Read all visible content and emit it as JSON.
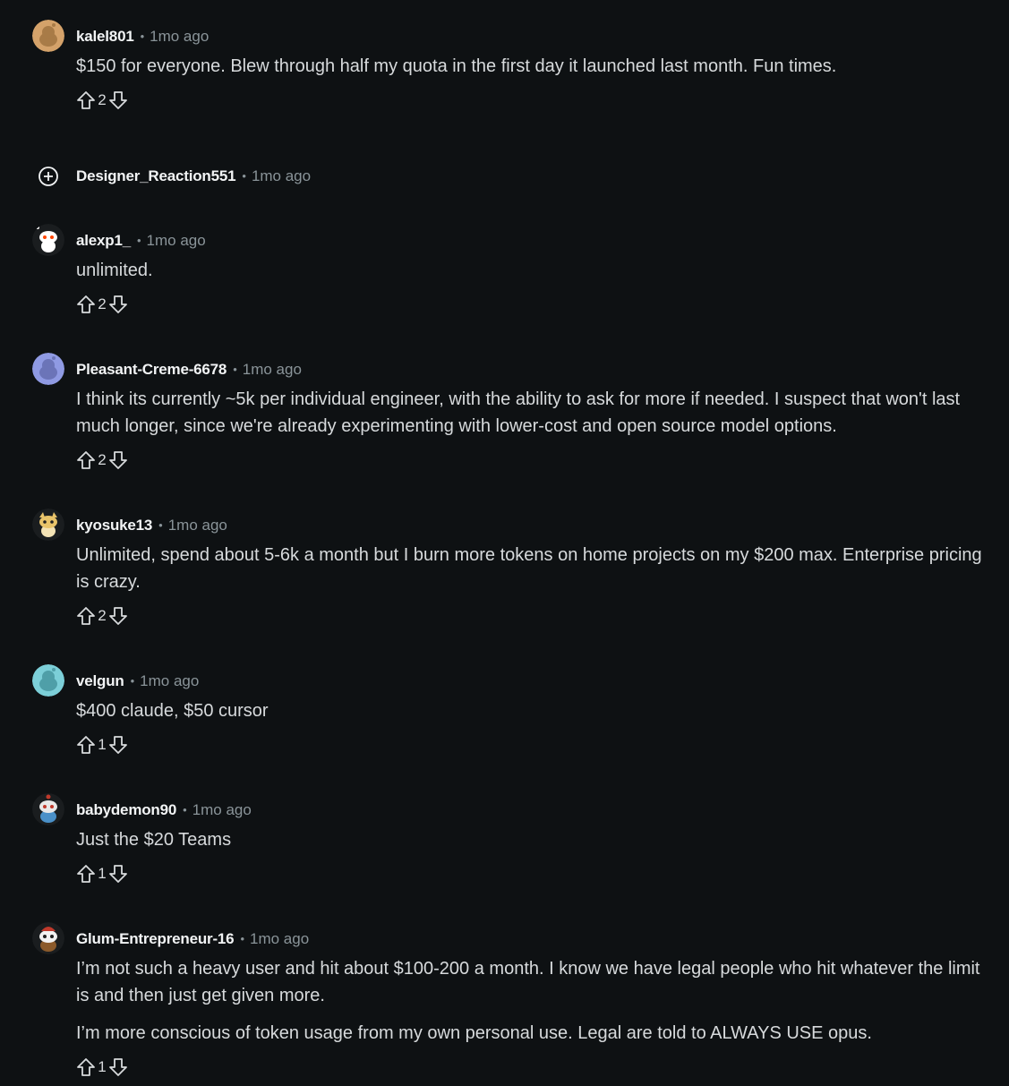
{
  "comments": [
    {
      "author": "kalel801",
      "time": "1mo ago",
      "avatar_color": "#d4a26a",
      "paragraphs": [
        "$150 for everyone. Blew through half my quota in the first day it launched last month. Fun times."
      ],
      "score": "2"
    },
    {
      "author": "Designer_Reaction551",
      "time": "1mo ago",
      "collapsed": true,
      "expand_icon": "plus-circle-icon"
    },
    {
      "author": "alexp1_",
      "time": "1mo ago",
      "avatar_color": "#ffffff",
      "paragraphs": [
        "unlimited."
      ],
      "score": "2"
    },
    {
      "author": "Pleasant-Creme-6678",
      "time": "1mo ago",
      "avatar_color": "#8f9ae3",
      "paragraphs": [
        "I think its currently ~5k per individual engineer, with the ability to ask for more if needed. I suspect that won't last much longer, since we're already experimenting with lower-cost and open source model options."
      ],
      "score": "2"
    },
    {
      "author": "kyosuke13",
      "time": "1mo ago",
      "avatar_color": "#e9c46a",
      "paragraphs": [
        "Unlimited, spend about 5-6k a month but I burn more tokens on home projects on my $200 max. Enterprise pricing is crazy."
      ],
      "score": "2"
    },
    {
      "author": "velgun",
      "time": "1mo ago",
      "avatar_color": "#7ccfd8",
      "paragraphs": [
        "$400 claude, $50 cursor"
      ],
      "score": "1"
    },
    {
      "author": "babydemon90",
      "time": "1mo ago",
      "avatar_color": "#4a90c8",
      "paragraphs": [
        "Just the $20 Teams"
      ],
      "score": "1"
    },
    {
      "author": "Glum-Entrepreneur-16",
      "time": "1mo ago",
      "avatar_color": "#c0392b",
      "paragraphs": [
        "I’m not such a heavy user and hit about $100-200 a month. I know we have legal people who hit whatever the limit is and then just get given more.",
        "I’m more conscious of token usage from my own personal use. Legal are told to ALWAYS USE opus."
      ],
      "score": "1"
    }
  ],
  "icons": {
    "upvote": "upvote-arrow-icon",
    "downvote": "downvote-arrow-icon"
  },
  "colors": {
    "background": "#0e1113",
    "text": "#d7dadc",
    "muted": "#8a9499"
  }
}
